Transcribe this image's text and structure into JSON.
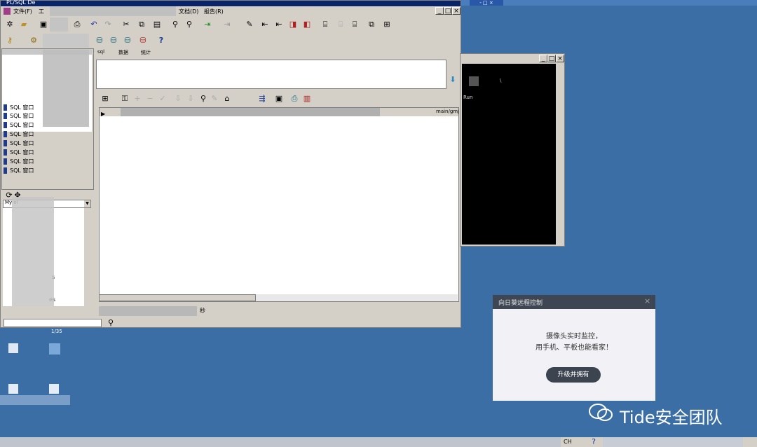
{
  "main_window": {
    "title": "PL/SQL De",
    "menu": [
      "文件(F)",
      "工",
      "文档(D)",
      "报告(R)"
    ],
    "caption_buttons": [
      "_",
      "□",
      "×"
    ]
  },
  "sql_windows": {
    "items": [
      "SQL 窗口",
      "SQL 窗口",
      "SQL 窗口",
      "SQL 窗口",
      "SQL 窗口",
      "SQL 窗口",
      "SQL 窗口",
      "SQL 窗口"
    ],
    "tab_labels": [
      "sql",
      "数据",
      "统计"
    ]
  },
  "object_browser": {
    "filter_value": "My ol",
    "tree_suffixes": [
      "s",
      "es"
    ]
  },
  "grid": {
    "header_right": "main/gmj"
  },
  "status_bar": {
    "time_text": "秒",
    "bottom_value": "1/35"
  },
  "console_window": {
    "lines": [
      "\\",
      "Run"
    ]
  },
  "popup": {
    "title": "向日葵远程控制",
    "close": "×",
    "line1": "摄像头实时监控，",
    "line2": "用手机、平板也能看家！",
    "button": "升级并拥有"
  },
  "watermark": {
    "text": "Tide安全团队"
  },
  "taskbar": {
    "lang": "CH"
  },
  "colors": {
    "desktop": "#3a6ea5",
    "window_face": "#d4d0c8",
    "popup_button": "#3c4450"
  }
}
